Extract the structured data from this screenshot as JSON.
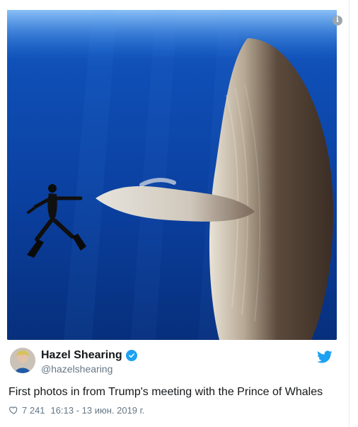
{
  "tweet": {
    "author_name": "Hazel Shearing",
    "author_handle": "@hazelshearing",
    "text": "First photos in from Trump's meeting with the Prince of Whales",
    "likes": "7 241",
    "timestamp": "16:13 - 13 июн. 2019 г."
  },
  "icons": {
    "info": "info-icon",
    "verified": "verified-badge-icon",
    "brand": "twitter-bird-icon",
    "like": "heart-icon"
  },
  "colors": {
    "accent": "#1da1f2",
    "text_primary": "#14171a",
    "text_secondary": "#657786",
    "ocean": "#0b3d91"
  }
}
